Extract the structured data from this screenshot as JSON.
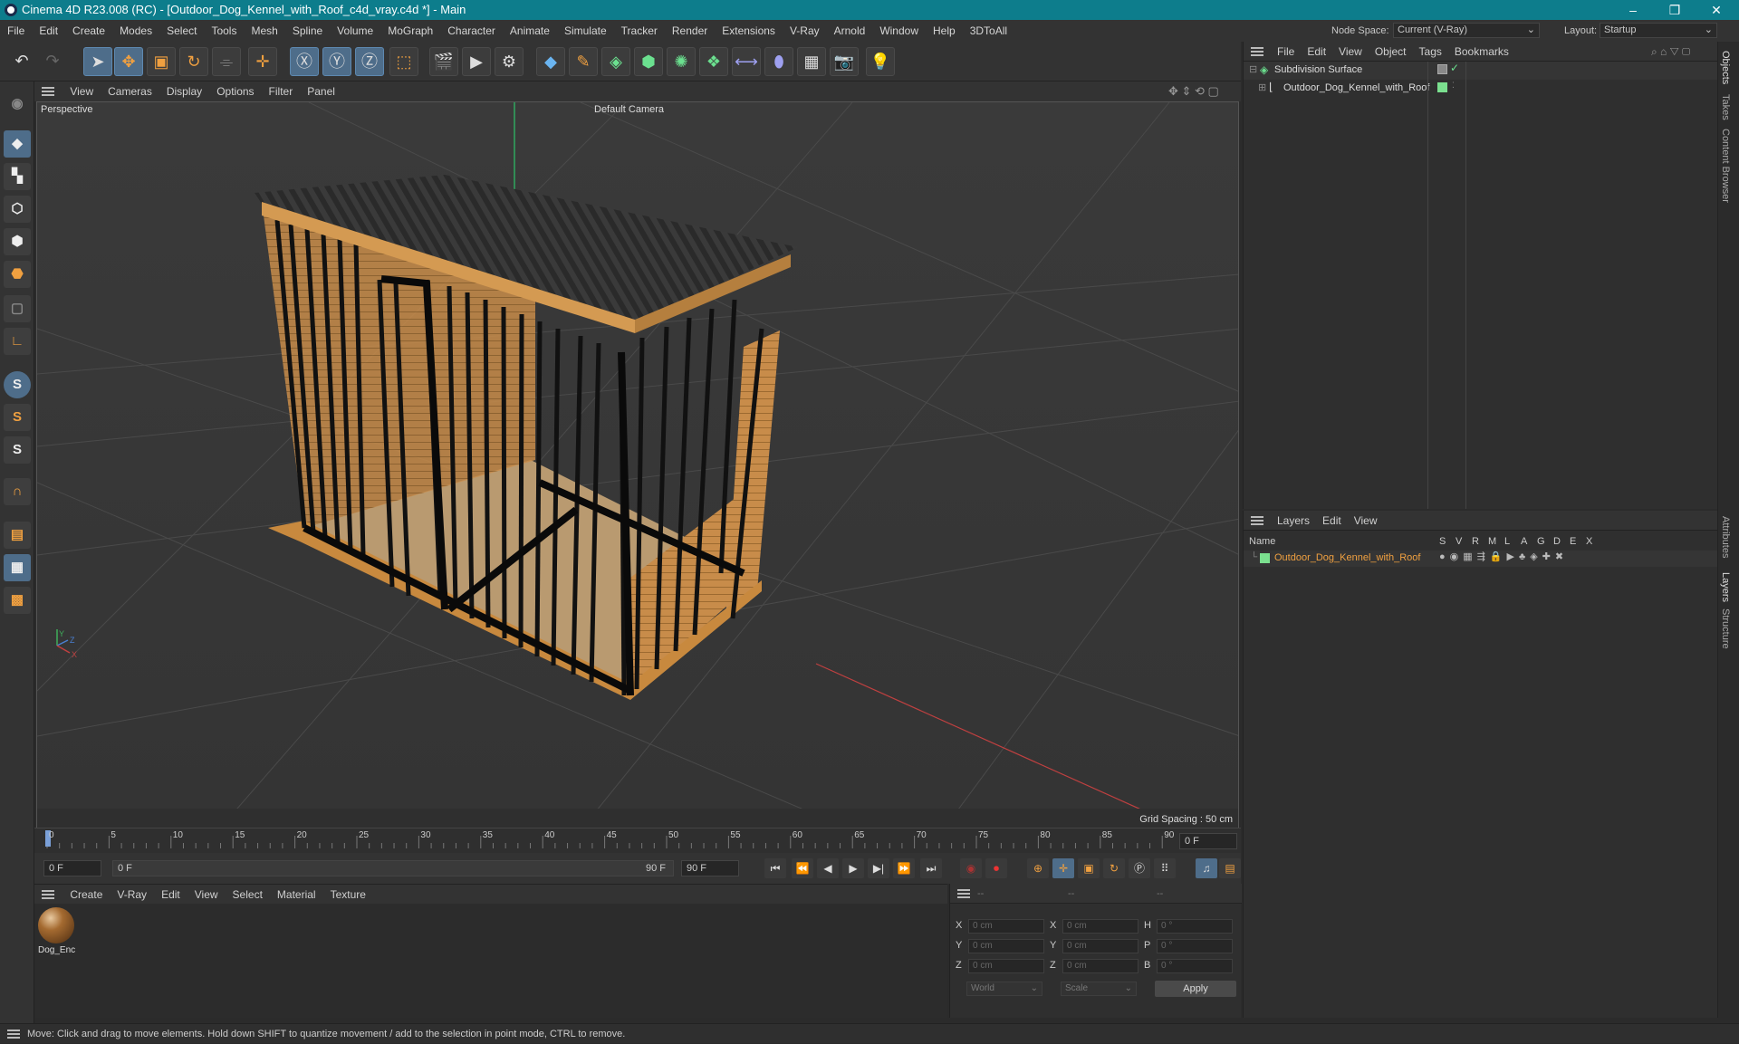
{
  "window": {
    "title": "Cinema 4D R23.008 (RC) - [Outdoor_Dog_Kennel_with_Roof_c4d_vray.c4d *] - Main",
    "controls": [
      "–",
      "❐",
      "✕"
    ]
  },
  "menubar": {
    "items": [
      "File",
      "Edit",
      "Create",
      "Modes",
      "Select",
      "Tools",
      "Mesh",
      "Spline",
      "Volume",
      "MoGraph",
      "Character",
      "Animate",
      "Simulate",
      "Tracker",
      "Render",
      "Extensions",
      "V-Ray",
      "Arnold",
      "Window",
      "Help",
      "3DToAll"
    ],
    "node_space_label": "Node Space:",
    "node_space_value": "Current (V-Ray)",
    "layout_label": "Layout:",
    "layout_value": "Startup"
  },
  "viewport": {
    "menu": [
      "View",
      "Cameras",
      "Display",
      "Options",
      "Filter",
      "Panel"
    ],
    "view_name": "Perspective",
    "camera_label": "Default Camera",
    "grid_spacing": "Grid Spacing : 50 cm",
    "axis_labels": {
      "y": "Y",
      "z": "Z",
      "x": "X"
    }
  },
  "timeline": {
    "ticks": [
      "0",
      "5",
      "10",
      "15",
      "20",
      "25",
      "30",
      "35",
      "40",
      "45",
      "50",
      "55",
      "60",
      "65",
      "70",
      "75",
      "80",
      "85",
      "90"
    ],
    "current_frame_right": "0 F",
    "start_field": "0 F",
    "range_start": "0 F",
    "range_end": "90 F",
    "end_field": "90 F"
  },
  "materials": {
    "menu": [
      "Create",
      "V-Ray",
      "Edit",
      "View",
      "Select",
      "Material",
      "Texture"
    ],
    "items": [
      {
        "name": "Dog_Enc"
      }
    ]
  },
  "coordinates": {
    "headers": [
      "--",
      "--",
      "--"
    ],
    "rows": [
      {
        "a_label": "X",
        "a_val": "0 cm",
        "b_label": "X",
        "b_val": "0 cm",
        "c_label": "H",
        "c_val": "0 °"
      },
      {
        "a_label": "Y",
        "a_val": "0 cm",
        "b_label": "Y",
        "b_val": "0 cm",
        "c_label": "P",
        "c_val": "0 °"
      },
      {
        "a_label": "Z",
        "a_val": "0 cm",
        "b_label": "Z",
        "b_val": "0 cm",
        "c_label": "B",
        "c_val": "0 °"
      }
    ],
    "space": "World",
    "mode": "Scale",
    "apply": "Apply"
  },
  "objects_panel": {
    "menu": [
      "File",
      "Edit",
      "View",
      "Object",
      "Tags",
      "Bookmarks"
    ],
    "tree": [
      {
        "name": "Subdivision Surface"
      },
      {
        "name": "Outdoor_Dog_Kennel_with_Roof"
      }
    ]
  },
  "layers_panel": {
    "menu": [
      "Layers",
      "Edit",
      "View"
    ],
    "columns": [
      "Name",
      "S",
      "V",
      "R",
      "M",
      "L",
      "A",
      "G",
      "D",
      "E",
      "X"
    ],
    "rows": [
      {
        "name": "Outdoor_Dog_Kennel_with_Roof",
        "color": "#7be08f"
      }
    ]
  },
  "side_tabs": [
    "Objects",
    "Takes",
    "Content Browser",
    "Attributes",
    "Layers",
    "Structure"
  ],
  "status": "Move: Click and drag to move elements. Hold down SHIFT to quantize movement / add to the selection in point mode, CTRL to remove.",
  "colors": {
    "accent": "#0d7d8c",
    "active_tool": "#4e6d8a",
    "layer_orange": "#f0a040"
  }
}
